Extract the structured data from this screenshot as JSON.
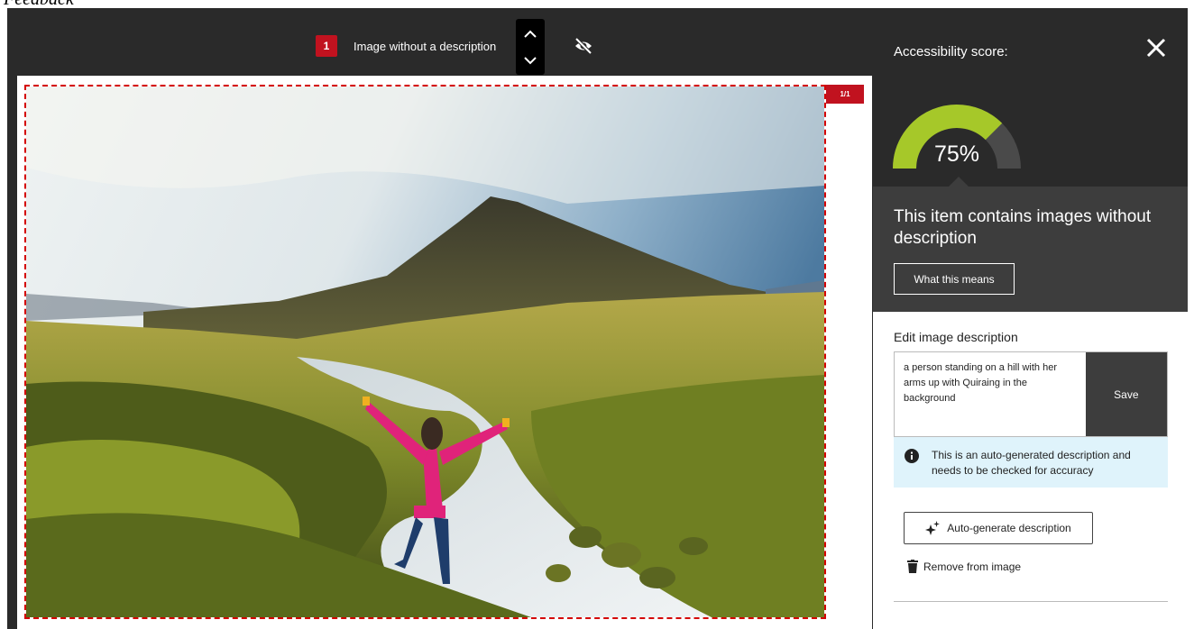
{
  "page": {
    "heading": "Feedback"
  },
  "toolbar": {
    "issue_number": "1",
    "issue_label": "Image without a description",
    "icons": {
      "prev": "chevron-up-icon",
      "next": "chevron-down-icon",
      "visibility": "eye-off-icon"
    }
  },
  "canvas": {
    "image_count": "1/1",
    "image_alt": "a person standing on a hill with her arms up with Quiraing in the background"
  },
  "panel": {
    "score_label": "Accessibility score:",
    "score_value": "75%",
    "score_percent": 75,
    "close_icon": "close-icon",
    "info_heading": "This item contains images without description",
    "what_this_means": "What this means",
    "edit_label": "Edit image description",
    "description_value": "a person standing on a hill with her arms up with Quiraing in the background",
    "save_label": "Save",
    "notice_text": "This is an auto-generated description and needs to be checked for accuracy",
    "autogen_label": "Auto-generate description",
    "remove_label": "Remove from image"
  },
  "colors": {
    "frame_bg": "#2a2a2a",
    "panel_info_bg": "#3d3d3d",
    "badge_red": "#c1121f",
    "gauge_fill": "#a6c829",
    "gauge_track": "#4a4a4a",
    "notice_bg": "#dff3fb"
  }
}
